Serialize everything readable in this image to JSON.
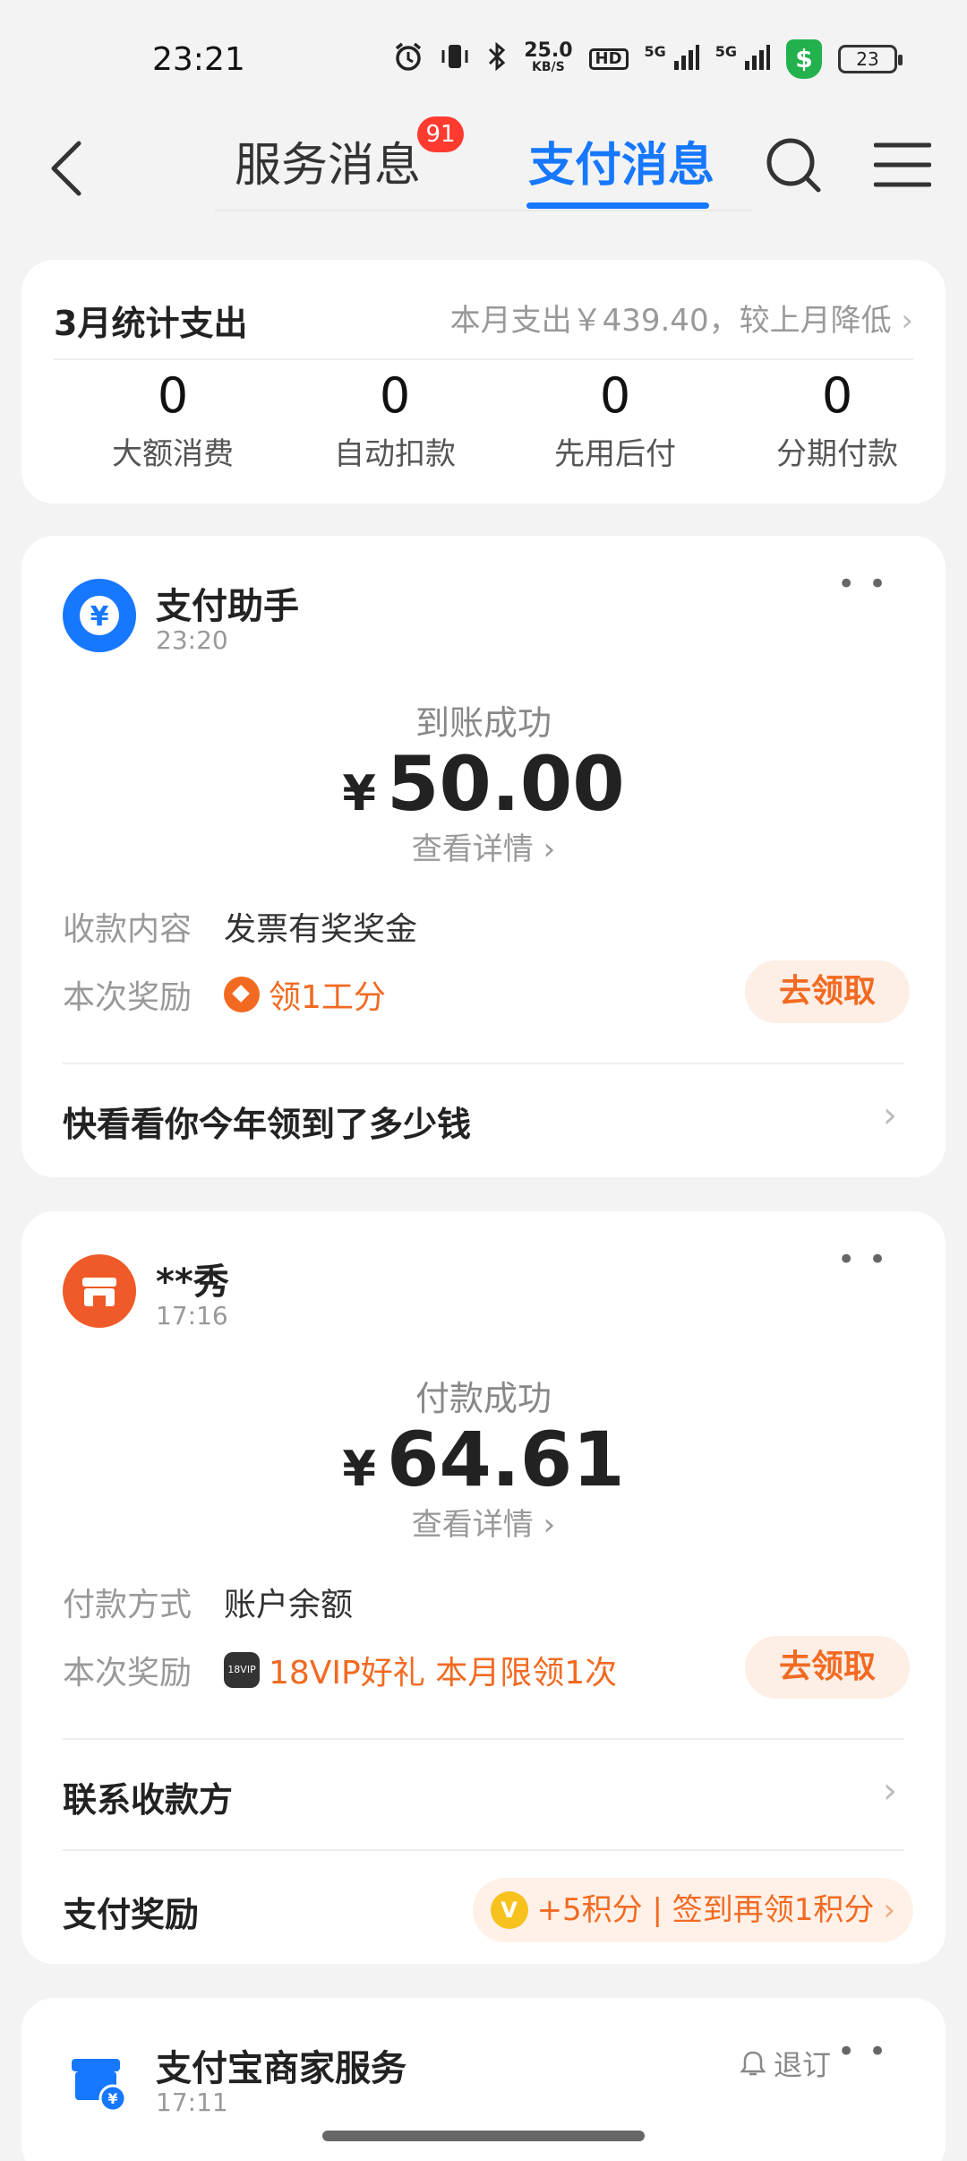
{
  "status_bar": {
    "time": "23:21",
    "net_speed_value": "25.0",
    "net_speed_unit": "KB/S",
    "hd": "HD",
    "sim1": "5G",
    "sim2": "5G",
    "battery": "23",
    "icons": [
      "alarm-icon",
      "vibrate-icon",
      "bluetooth-icon",
      "shield-icon"
    ]
  },
  "nav": {
    "tabs": [
      {
        "label": "服务消息",
        "badge": "91"
      },
      {
        "label": "支付消息"
      }
    ],
    "active_tab": 1,
    "accent_color": "#1677ff"
  },
  "stats": {
    "title": "3月统计支出",
    "summary": "本月支出￥439.40，较上月降低",
    "items": [
      {
        "value": "0",
        "label": "大额消费"
      },
      {
        "value": "0",
        "label": "自动扣款"
      },
      {
        "value": "0",
        "label": "先用后付"
      },
      {
        "value": "0",
        "label": "分期付款"
      }
    ]
  },
  "messages": [
    {
      "sender": "支付助手",
      "time": "23:20",
      "status": "到账成功",
      "currency": "¥",
      "amount": "50.00",
      "detail_link": "查看详情",
      "rows": [
        {
          "label": "收款内容",
          "value": "发票有奖奖金"
        },
        {
          "label": "本次奖励",
          "value": "领1工分"
        }
      ],
      "claim_label": "去领取",
      "footer_link": "快看看你今年领到了多少钱"
    },
    {
      "sender": "**秀",
      "time": "17:16",
      "status": "付款成功",
      "currency": "¥",
      "amount": "64.61",
      "detail_link": "查看详情",
      "rows": [
        {
          "label": "付款方式",
          "value": "账户余额"
        },
        {
          "label": "本次奖励",
          "value": "18VIP好礼 本月限领1次"
        }
      ],
      "vip_icon_text": "18VIP",
      "claim_label": "去领取",
      "contact_link": "联系收款方",
      "pay_reward_label": "支付奖励",
      "pay_reward_value": "+5积分 | 签到再领1积分",
      "coin_letter": "V"
    },
    {
      "sender": "支付宝商家服务",
      "time": "17:11",
      "unsubscribe": "退订"
    }
  ]
}
